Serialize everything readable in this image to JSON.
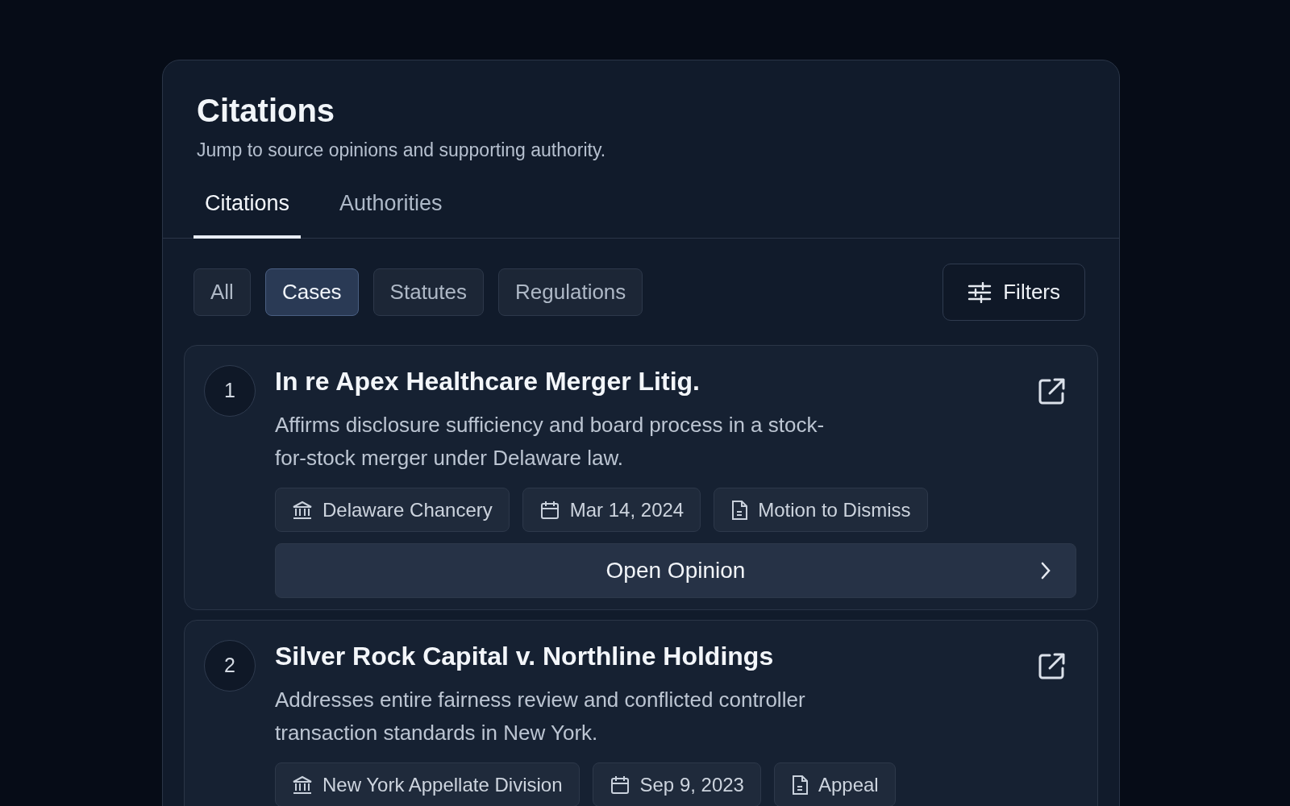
{
  "header": {
    "title": "Citations",
    "subtitle": "Jump to source opinions and supporting authority."
  },
  "tabs": [
    {
      "label": "Citations",
      "selected": true
    },
    {
      "label": "Authorities",
      "selected": false
    }
  ],
  "filter_chips": [
    {
      "label": "All",
      "selected": false
    },
    {
      "label": "Cases",
      "selected": true
    },
    {
      "label": "Statutes",
      "selected": false
    },
    {
      "label": "Regulations",
      "selected": false
    }
  ],
  "filters_button": "Filters",
  "citations": [
    {
      "number": "1",
      "title": "In re Apex Healthcare Merger Litig.",
      "description": "Affirms disclosure sufficiency and board process in a stock-for-stock merger under Delaware law.",
      "meta": [
        {
          "kind": "court",
          "text": "Delaware Chancery"
        },
        {
          "kind": "date",
          "text": "Mar 14, 2024"
        },
        {
          "kind": "document",
          "text": "Motion to Dismiss"
        }
      ],
      "action": "Open Opinion"
    },
    {
      "number": "2",
      "title": "Silver Rock Capital v. Northline Holdings",
      "description": "Addresses entire fairness review and conflicted controller transaction standards in New York.",
      "meta": [
        {
          "kind": "court",
          "text": "New York Appellate Division"
        },
        {
          "kind": "date",
          "text": "Sep 9, 2023"
        },
        {
          "kind": "document",
          "text": "Appeal"
        }
      ]
    }
  ]
}
